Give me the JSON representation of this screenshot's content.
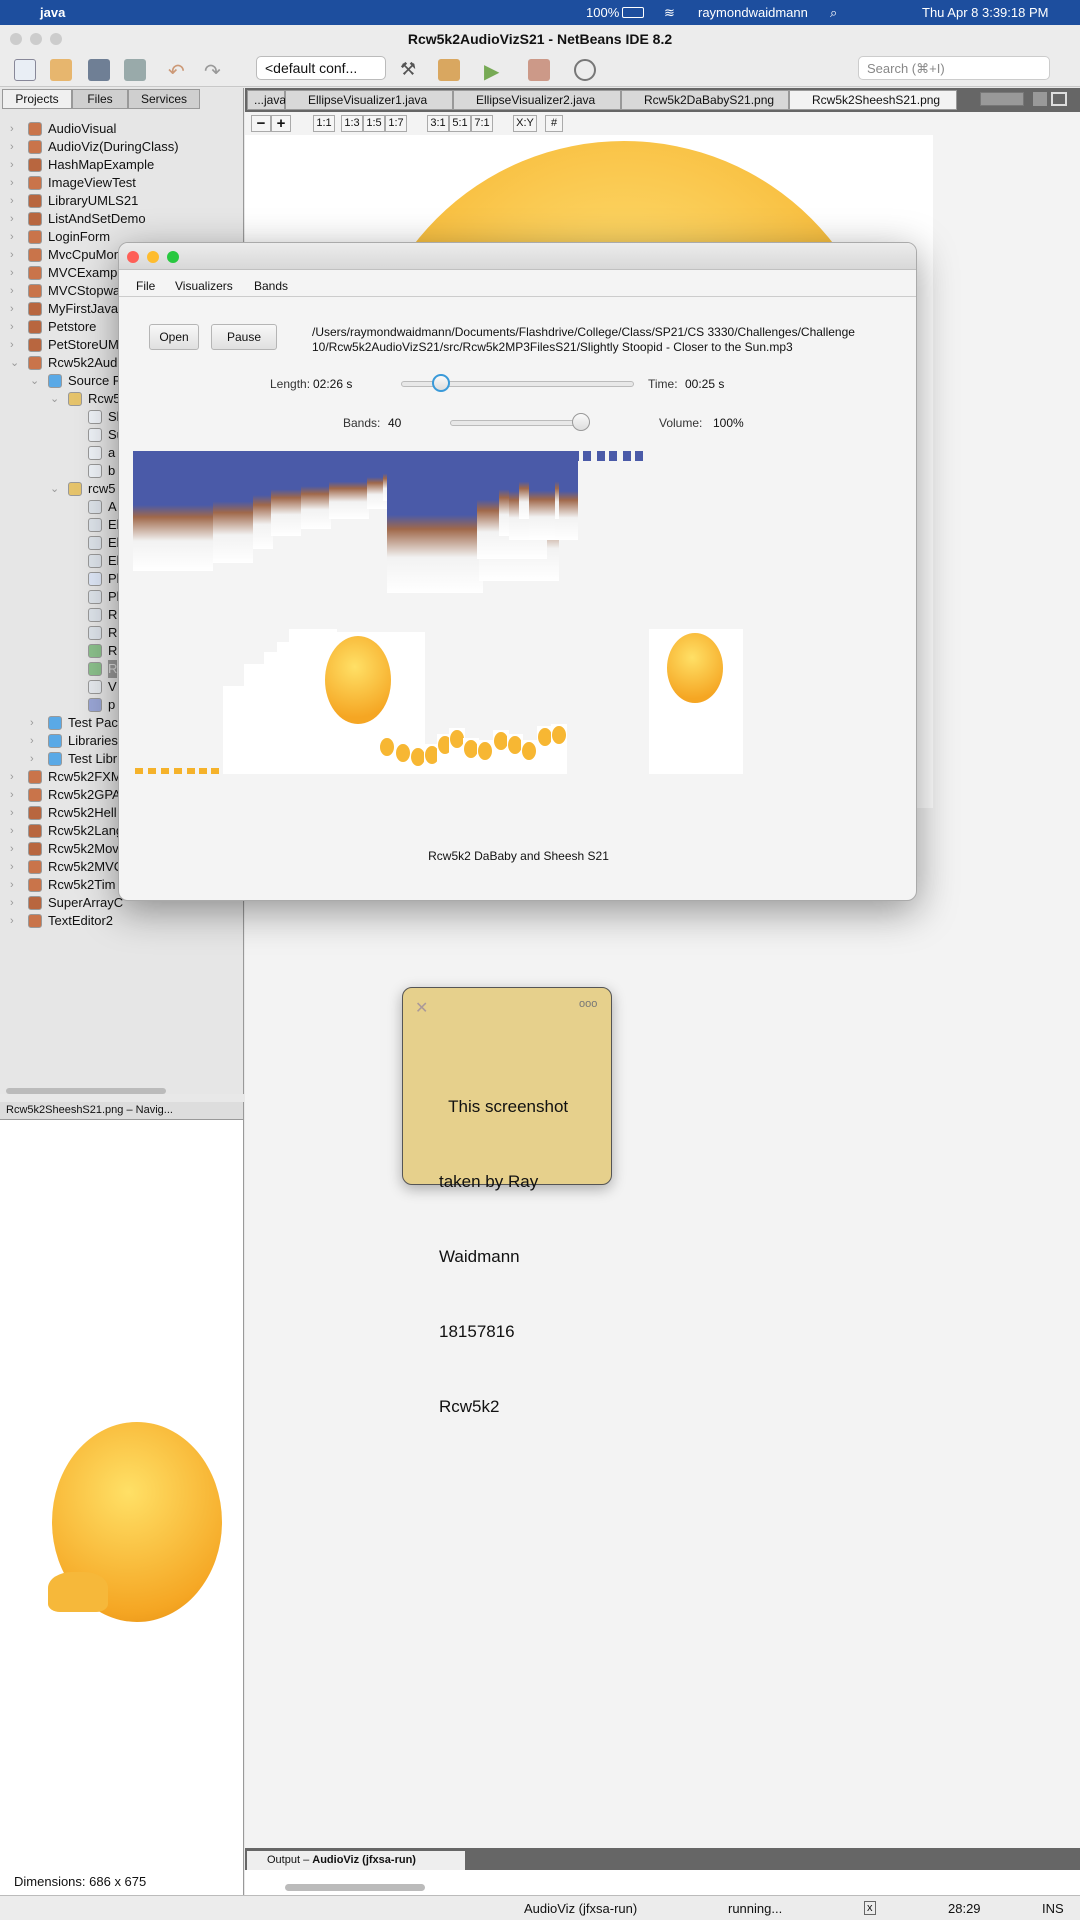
{
  "menubar": {
    "app": "java",
    "battery": "100%",
    "user": "raymondwaidmann",
    "datetime": "Thu Apr 8  3:39:18 PM"
  },
  "window": {
    "title": "Rcw5k2AudioVizS21 - NetBeans IDE 8.2"
  },
  "toolbar": {
    "config": "<default conf...",
    "search_placeholder": "Search (⌘+I)"
  },
  "left_tabs": [
    "Projects",
    "Files",
    "Services"
  ],
  "tree": [
    {
      "label": "AudioVisual",
      "level": 0,
      "icon": "fx-project"
    },
    {
      "label": "AudioViz(DuringClass)",
      "level": 0,
      "icon": "fx-project"
    },
    {
      "label": "HashMapExample",
      "level": 0,
      "icon": "java-project"
    },
    {
      "label": "ImageViewTest",
      "level": 0,
      "icon": "fx-project"
    },
    {
      "label": "LibraryUMLS21",
      "level": 0,
      "icon": "java-project"
    },
    {
      "label": "ListAndSetDemo",
      "level": 0,
      "icon": "java-project"
    },
    {
      "label": "LoginForm",
      "level": 0,
      "icon": "fx-project"
    },
    {
      "label": "MvcCpuMonit",
      "level": 0,
      "icon": "fx-project"
    },
    {
      "label": "MVCExampl",
      "level": 0,
      "icon": "fx-project"
    },
    {
      "label": "MVCStopwat",
      "level": 0,
      "icon": "fx-project"
    },
    {
      "label": "MyFirstJavaF",
      "level": 0,
      "icon": "java-project"
    },
    {
      "label": "Petstore",
      "level": 0,
      "icon": "java-project"
    },
    {
      "label": "PetStoreUML",
      "level": 0,
      "icon": "java-project"
    },
    {
      "label": "Rcw5k2Aud",
      "level": 0,
      "icon": "fx-project",
      "open": true
    },
    {
      "label": "Source P",
      "level": 1,
      "icon": "folder",
      "open": true
    },
    {
      "label": "Rcw5",
      "level": 2,
      "icon": "package",
      "open": true
    },
    {
      "label": "Sl",
      "level": 3,
      "icon": "file"
    },
    {
      "label": "Su",
      "level": 3,
      "icon": "file"
    },
    {
      "label": "a",
      "level": 3,
      "icon": "file"
    },
    {
      "label": "b",
      "level": 3,
      "icon": "file"
    },
    {
      "label": "rcw5",
      "level": 2,
      "icon": "package",
      "open": true
    },
    {
      "label": "A",
      "level": 3,
      "icon": "java-run"
    },
    {
      "label": "El",
      "level": 3,
      "icon": "java"
    },
    {
      "label": "El",
      "level": 3,
      "icon": "java"
    },
    {
      "label": "El",
      "level": 3,
      "icon": "java"
    },
    {
      "label": "Pl",
      "level": 3,
      "icon": "fxml"
    },
    {
      "label": "Pl",
      "level": 3,
      "icon": "java"
    },
    {
      "label": "R",
      "level": 3,
      "icon": "java"
    },
    {
      "label": "R",
      "level": 3,
      "icon": "java"
    },
    {
      "label": "R",
      "level": 3,
      "icon": "image"
    },
    {
      "label": "R",
      "level": 3,
      "icon": "image",
      "selected": true
    },
    {
      "label": "V",
      "level": 3,
      "icon": "interface"
    },
    {
      "label": "p",
      "level": 3,
      "icon": "properties"
    },
    {
      "label": "Test Pac",
      "level": 1,
      "icon": "folder"
    },
    {
      "label": "Libraries",
      "level": 1,
      "icon": "library"
    },
    {
      "label": "Test Libr",
      "level": 1,
      "icon": "library"
    },
    {
      "label": "Rcw5k2FXM",
      "level": 0,
      "icon": "fx-project"
    },
    {
      "label": "Rcw5k2GPA",
      "level": 0,
      "icon": "fx-project"
    },
    {
      "label": "Rcw5k2Hell",
      "level": 0,
      "icon": "java-project"
    },
    {
      "label": "Rcw5k2Lang",
      "level": 0,
      "icon": "java-project"
    },
    {
      "label": "Rcw5k2Mov",
      "level": 0,
      "icon": "java-project"
    },
    {
      "label": "Rcw5k2MVC",
      "level": 0,
      "icon": "fx-project"
    },
    {
      "label": "Rcw5k2Tim",
      "level": 0,
      "icon": "fx-project"
    },
    {
      "label": "SuperArrayC",
      "level": 0,
      "icon": "java-project"
    },
    {
      "label": "TextEditor2",
      "level": 0,
      "icon": "fx-project"
    }
  ],
  "navigator": {
    "title": "Rcw5k2SheeshS21.png – Navig...",
    "dimensions": "Dimensions: 686 x 675"
  },
  "editor_tabs": [
    "...java",
    "EllipseVisualizer1.java",
    "EllipseVisualizer2.java",
    "Rcw5k2DaBabyS21.png",
    "Rcw5k2SheeshS21.png"
  ],
  "zoom_buttons": [
    "−",
    "+",
    "1:1",
    "1:3",
    "1:5",
    "1:7",
    "3:1",
    "5:1",
    "7:1",
    "X:Y",
    "#"
  ],
  "app": {
    "menus": [
      "File",
      "Visualizers",
      "Bands"
    ],
    "open": "Open",
    "pause": "Pause",
    "path_line1": "/Users/raymondwaidmann/Documents/Flashdrive/College/Class/SP21/CS 3330/Challenges/Challenge",
    "path_line2": "10/Rcw5k2AudioVizS21/src/Rcw5k2MP3FilesS21/Slightly Stoopid - Closer to the Sun.mp3",
    "length_label": "Length:",
    "length": "02:26 s",
    "time_label": "Time:",
    "time": "00:25 s",
    "progress_fraction": 0.17,
    "bands_label": "Bands:",
    "bands": "40",
    "bands_fraction": 1.0,
    "volume_label": "Volume:",
    "volume": "100%",
    "visualizer_name": "Rcw5k2 DaBaby and Sheesh S21"
  },
  "sticky": {
    "text_lines": [
      "  This screenshot",
      "taken by Ray",
      "Waidmann",
      "18157816",
      "Rcw5k2"
    ]
  },
  "output": {
    "tab": "Output – ",
    "tab_bold": "AudioViz (jfxsa-run)"
  },
  "status": {
    "task": "AudioViz (jfxsa-run)",
    "state": "running...",
    "position": "28:29",
    "mode": "INS"
  }
}
